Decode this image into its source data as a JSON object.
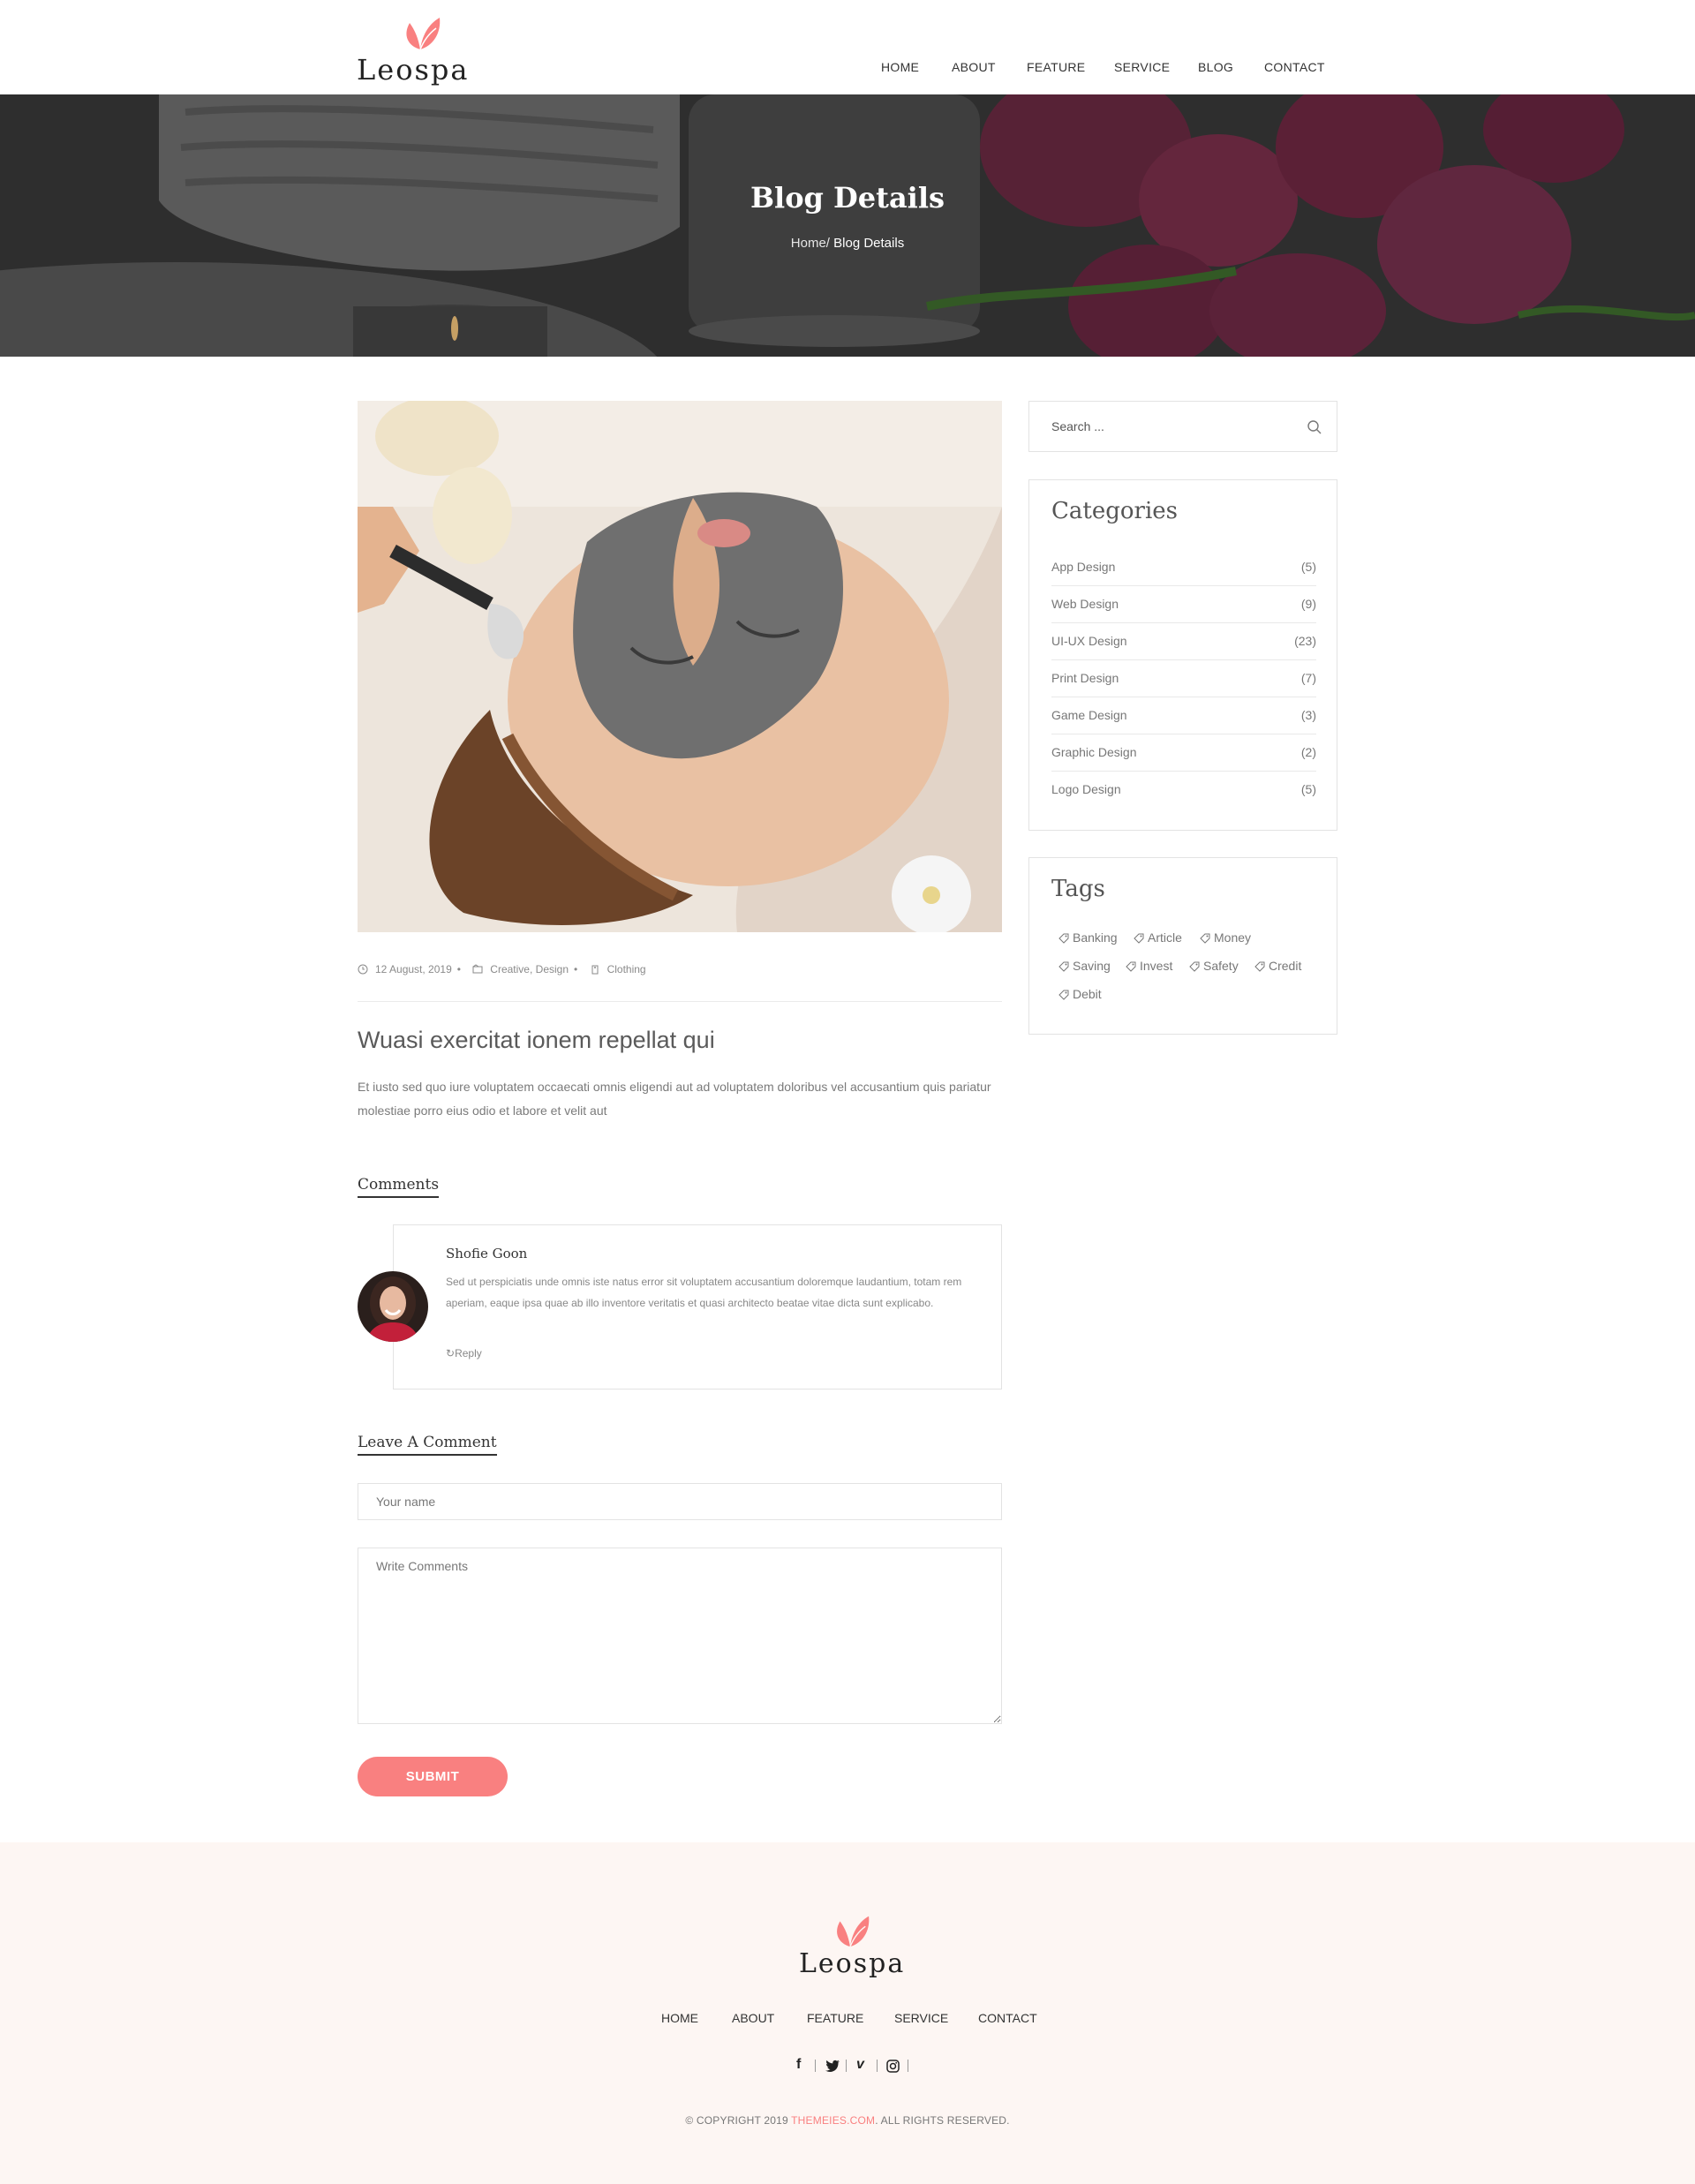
{
  "brand": {
    "name": "Leospa",
    "accent": "#f98080"
  },
  "nav": [
    "HOME",
    "ABOUT",
    "FEATURE",
    "SERVICE",
    "BLOG",
    "CONTACT"
  ],
  "hero": {
    "title": "Blog Details",
    "crumb_home": "Home/",
    "crumb_current": " Blog Details"
  },
  "post": {
    "date": "12 August, 2019",
    "category": "Creative, Design",
    "tag": "Clothing",
    "title": "Wuasi exercitat ionem repellat qui",
    "body": "Et iusto sed quo iure voluptatem occaecati omnis eligendi aut ad voluptatem doloribus vel accusantium quis pariatur molestiae porro eius odio et labore et velit aut"
  },
  "comments": {
    "heading": "Comments",
    "items": [
      {
        "name": "Shofie Goon",
        "text": "Sed ut perspiciatis unde omnis iste natus error sit voluptatem accusantium doloremque laudantium, totam rem aperiam, eaque ipsa quae ab illo inventore veritatis et quasi architecto beatae vitae dicta sunt explicabo.",
        "reply": "Reply"
      }
    ]
  },
  "form": {
    "heading": "Leave A Comment",
    "name_placeholder": "Your name",
    "comment_placeholder": "Write Comments",
    "submit": "SUBMIT"
  },
  "sidebar": {
    "search_placeholder": "Search ...",
    "categories_title": "Categories",
    "categories": [
      {
        "name": "App Design",
        "count": "(5)"
      },
      {
        "name": "Web Design",
        "count": "(9)"
      },
      {
        "name": "UI-UX Design",
        "count": "(23)"
      },
      {
        "name": "Print Design",
        "count": "(7)"
      },
      {
        "name": "Game Design",
        "count": "(3)"
      },
      {
        "name": "Graphic Design",
        "count": "(2)"
      },
      {
        "name": "Logo Design",
        "count": "(5)"
      }
    ],
    "tags_title": "Tags",
    "tags": [
      "Banking",
      "Article",
      "Money",
      "Saving",
      "Invest",
      "Safety",
      "Credit",
      "Debit"
    ]
  },
  "footer": {
    "nav": [
      "HOME",
      "ABOUT",
      "FEATURE",
      "SERVICE",
      "CONTACT"
    ],
    "social": [
      "facebook-icon",
      "twitter-icon",
      "vimeo-icon",
      "instagram-icon"
    ],
    "copyright_pre": "© COPYRIGHT 2019 ",
    "copyright_brand": "THEMEIES.COM",
    "copyright_post": ". ALL RIGHTS RESERVED."
  }
}
